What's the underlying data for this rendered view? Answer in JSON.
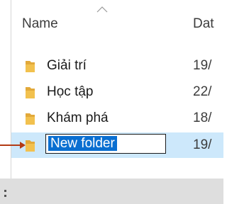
{
  "header": {
    "name_label": "Name",
    "date_label": "Dat"
  },
  "rows": [
    {
      "name": "Giải trí",
      "date": "19/"
    },
    {
      "name": "Học tập",
      "date": "22/"
    },
    {
      "name": "Khám phá",
      "date": "18/"
    }
  ],
  "selected_row": {
    "rename_value": "New folder",
    "date": "19/"
  },
  "colors": {
    "folder": "#f2c14e",
    "selection_row": "#cde8fb",
    "selection_text": "#0a6fd1",
    "pointer": "#b33a14"
  },
  "icons": {
    "folder": "folder-icon",
    "sort": "sort-up-chevron-icon"
  }
}
